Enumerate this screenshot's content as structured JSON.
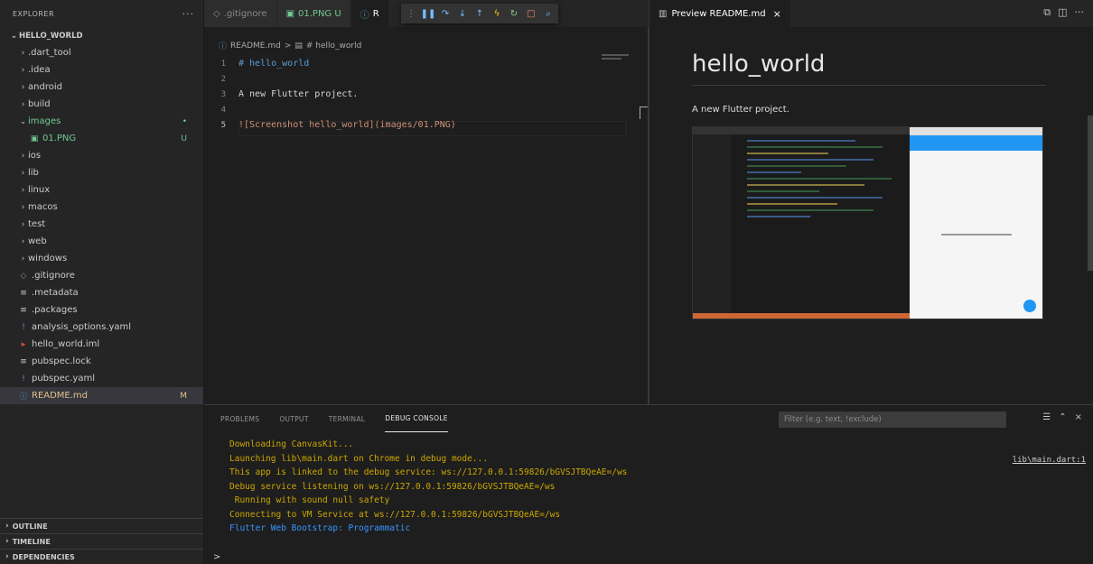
{
  "sidebar": {
    "title": "EXPLORER",
    "more": "···",
    "project": "HELLO_WORLD",
    "items": [
      {
        "label": ".dart_tool",
        "kind": "folder",
        "level": 1,
        "open": false
      },
      {
        "label": ".idea",
        "kind": "folder",
        "level": 1,
        "open": false
      },
      {
        "label": "android",
        "kind": "folder",
        "level": 1,
        "open": false
      },
      {
        "label": "build",
        "kind": "folder",
        "level": 1,
        "open": false
      },
      {
        "label": "images",
        "kind": "folder",
        "level": 1,
        "open": true,
        "badge": "•"
      },
      {
        "label": "01.PNG",
        "kind": "image",
        "level": 2,
        "badge": "U"
      },
      {
        "label": "ios",
        "kind": "folder",
        "level": 1,
        "open": false
      },
      {
        "label": "lib",
        "kind": "folder",
        "level": 1,
        "open": false
      },
      {
        "label": "linux",
        "kind": "folder",
        "level": 1,
        "open": false
      },
      {
        "label": "macos",
        "kind": "folder",
        "level": 1,
        "open": false
      },
      {
        "label": "test",
        "kind": "folder",
        "level": 1,
        "open": false
      },
      {
        "label": "web",
        "kind": "folder",
        "level": 1,
        "open": false
      },
      {
        "label": "windows",
        "kind": "folder",
        "level": 1,
        "open": false
      },
      {
        "label": ".gitignore",
        "kind": "file",
        "level": 1
      },
      {
        "label": ".metadata",
        "kind": "file",
        "level": 1
      },
      {
        "label": ".packages",
        "kind": "file",
        "level": 1
      },
      {
        "label": "analysis_options.yaml",
        "kind": "yaml",
        "level": 1
      },
      {
        "label": "hello_world.iml",
        "kind": "iml",
        "level": 1
      },
      {
        "label": "pubspec.lock",
        "kind": "file",
        "level": 1
      },
      {
        "label": "pubspec.yaml",
        "kind": "yaml",
        "level": 1
      },
      {
        "label": "README.md",
        "kind": "md",
        "level": 1,
        "badge": "M",
        "active": true
      }
    ],
    "sections": [
      "OUTLINE",
      "TIMELINE",
      "DEPENDENCIES"
    ]
  },
  "editor": {
    "tabs": [
      {
        "label": ".gitignore"
      },
      {
        "label": "01.PNG U"
      },
      {
        "label": "R"
      }
    ],
    "breadcrumb": {
      "file": "README.md",
      "sep": ">",
      "symbol": "# hello_world"
    },
    "lines": [
      {
        "num": "1",
        "text": "# hello_world",
        "style": "h1"
      },
      {
        "num": "2",
        "text": ""
      },
      {
        "num": "3",
        "text": "A new Flutter project."
      },
      {
        "num": "4",
        "text": ""
      },
      {
        "num": "5",
        "text": "![Screenshot hello_world](images/01.PNG)",
        "style": "lnk",
        "current": true
      }
    ]
  },
  "preview": {
    "tab_label": "Preview README.md",
    "heading": "hello_world",
    "paragraph": "A new Flutter project."
  },
  "panel": {
    "tabs": [
      "PROBLEMS",
      "OUTPUT",
      "TERMINAL",
      "DEBUG CONSOLE"
    ],
    "active_tab": "DEBUG CONSOLE",
    "filter_placeholder": "Filter (e.g. text, !exclude)",
    "console": [
      {
        "text": "Downloading CanvasKit...",
        "color": "yellow"
      },
      {
        "text": "Launching lib\\main.dart on Chrome in debug mode...",
        "color": "yellow"
      },
      {
        "text": "This app is linked to the debug service: ws://127.0.0.1:59826/bGVSJTBQeAE=/ws",
        "color": "yellow"
      },
      {
        "text": "Debug service listening on ws://127.0.0.1:59826/bGVSJTBQeAE=/ws",
        "color": "yellow"
      },
      {
        "text": " Running with sound null safety",
        "color": "yellow"
      },
      {
        "text": "Connecting to VM Service at ws://127.0.0.1:59826/bGVSJTBQeAE=/ws",
        "color": "yellow"
      },
      {
        "text": "Flutter Web Bootstrap: Programmatic",
        "color": "blue"
      }
    ],
    "source_link": "lib\\main.dart:1",
    "prompt": ">"
  },
  "colors": {
    "accent": "#007acc",
    "console_yellow": "#cca700",
    "console_blue": "#3794ff",
    "untracked": "#73c991",
    "modified": "#e2c08d"
  }
}
